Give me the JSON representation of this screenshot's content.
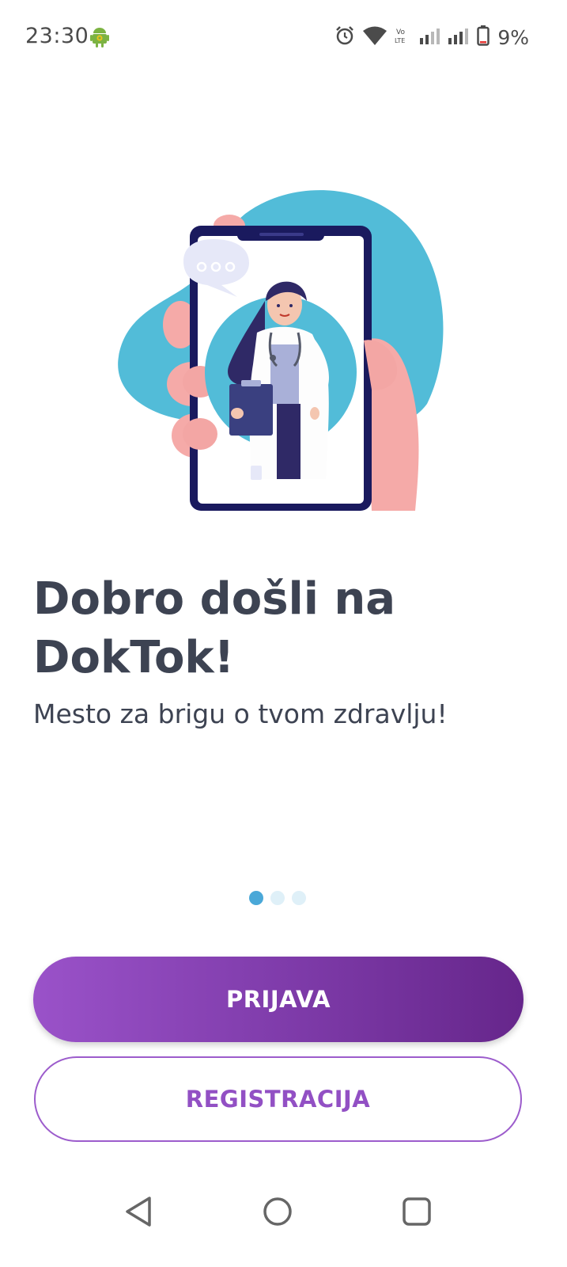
{
  "status_bar": {
    "time": "23:30",
    "battery": "9%",
    "icons": [
      "android-icon",
      "alarm-icon",
      "wifi-icon",
      "volte-icon",
      "signal-icon",
      "signal-icon",
      "battery-icon"
    ]
  },
  "welcome": {
    "title_line1": "Dobro došli na",
    "title_line2": "DokTok!",
    "subtitle": "Mesto za brigu o tvom zdravlju!"
  },
  "pager": {
    "total": 3,
    "active_index": 0
  },
  "buttons": {
    "login_label": "PRIJAVA",
    "register_label": "REGISTRACIJA"
  },
  "nav_bar": {
    "icons": [
      "back-icon",
      "home-icon",
      "recents-icon"
    ]
  },
  "colors": {
    "title_text": "#3d4352",
    "accent_purple": "#9250c4",
    "gradient_start": "#9a52c9",
    "gradient_end": "#66268b",
    "pager_active": "#4aa8d8",
    "pager_inactive": "#dff0f8",
    "blob_blue": "#52bcd8",
    "phone_frame": "#1a1a5e",
    "skin_pink": "#f5aaa8"
  }
}
